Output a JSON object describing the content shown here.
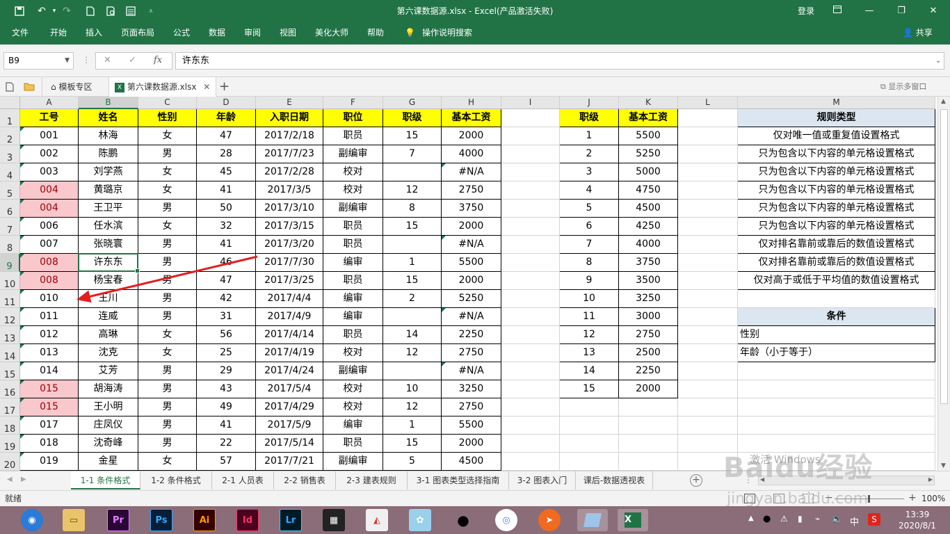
{
  "window": {
    "title": "第六课数据源.xlsx  -  Excel(产品激活失败)",
    "login": "登录"
  },
  "ribbon": {
    "tabs": [
      "文件",
      "开始",
      "插入",
      "页面布局",
      "公式",
      "数据",
      "审阅",
      "视图",
      "美化大师",
      "帮助",
      "操作说明搜索"
    ],
    "share": "共享"
  },
  "formula_bar": {
    "name_box": "B9",
    "content": "许东东",
    "fx": "fx"
  },
  "doc_tabs": {
    "template": "模板专区",
    "file": "第六课数据源.xlsx",
    "multi_window": "显示多窗口"
  },
  "columns": [
    "A",
    "B",
    "C",
    "D",
    "E",
    "F",
    "G",
    "H",
    "I",
    "J",
    "K",
    "L",
    "M"
  ],
  "rows": [
    "1",
    "2",
    "3",
    "4",
    "5",
    "6",
    "7",
    "8",
    "9",
    "10",
    "11",
    "12",
    "13",
    "14",
    "15",
    "16",
    "17",
    "18",
    "19",
    "20"
  ],
  "table1": {
    "headers": [
      "工号",
      "姓名",
      "性别",
      "年龄",
      "入职日期",
      "职位",
      "职级",
      "基本工资"
    ],
    "rows": [
      [
        "001",
        "林海",
        "女",
        "47",
        "2017/2/18",
        "职员",
        "15",
        "2000"
      ],
      [
        "002",
        "陈鹏",
        "男",
        "28",
        "2017/7/23",
        "副编审",
        "7",
        "4000"
      ],
      [
        "003",
        "刘学燕",
        "女",
        "45",
        "2017/2/28",
        "校对",
        "",
        "#N/A"
      ],
      [
        "004",
        "黄璐京",
        "女",
        "41",
        "2017/3/5",
        "校对",
        "12",
        "2750"
      ],
      [
        "004",
        "王卫平",
        "男",
        "50",
        "2017/3/10",
        "副编审",
        "8",
        "3750"
      ],
      [
        "006",
        "任水滨",
        "女",
        "32",
        "2017/3/15",
        "职员",
        "15",
        "2000"
      ],
      [
        "007",
        "张晓寰",
        "男",
        "41",
        "2017/3/20",
        "职员",
        "",
        "#N/A"
      ],
      [
        "008",
        "许东东",
        "男",
        "46",
        "2017/7/30",
        "编审",
        "1",
        "5500"
      ],
      [
        "008",
        "杨宝春",
        "男",
        "47",
        "2017/3/25",
        "职员",
        "15",
        "2000"
      ],
      [
        "010",
        "王川",
        "男",
        "42",
        "2017/4/4",
        "编审",
        "2",
        "5250"
      ],
      [
        "011",
        "连威",
        "男",
        "31",
        "2017/4/9",
        "编审",
        "",
        "#N/A"
      ],
      [
        "012",
        "高琳",
        "女",
        "56",
        "2017/4/14",
        "职员",
        "14",
        "2250"
      ],
      [
        "013",
        "沈克",
        "女",
        "25",
        "2017/4/19",
        "校对",
        "12",
        "2750"
      ],
      [
        "014",
        "艾芳",
        "男",
        "29",
        "2017/4/24",
        "副编审",
        "",
        "#N/A"
      ],
      [
        "015",
        "胡海涛",
        "男",
        "43",
        "2017/5/4",
        "校对",
        "10",
        "3250"
      ],
      [
        "015",
        "王小明",
        "男",
        "49",
        "2017/4/29",
        "校对",
        "12",
        "2750"
      ],
      [
        "017",
        "庄凤仪",
        "男",
        "41",
        "2017/5/9",
        "编审",
        "1",
        "5500"
      ],
      [
        "018",
        "沈奇峰",
        "男",
        "22",
        "2017/5/14",
        "职员",
        "15",
        "2000"
      ],
      [
        "019",
        "金星",
        "女",
        "57",
        "2017/7/21",
        "副编审",
        "5",
        "4500"
      ]
    ],
    "duplicate_rows": [
      3,
      4,
      7,
      8,
      14,
      15
    ]
  },
  "table2": {
    "headers": [
      "职级",
      "基本工资"
    ],
    "rows": [
      [
        "1",
        "5500"
      ],
      [
        "2",
        "5250"
      ],
      [
        "3",
        "5000"
      ],
      [
        "4",
        "4750"
      ],
      [
        "5",
        "4500"
      ],
      [
        "6",
        "4250"
      ],
      [
        "7",
        "4000"
      ],
      [
        "8",
        "3750"
      ],
      [
        "9",
        "3500"
      ],
      [
        "10",
        "3250"
      ],
      [
        "11",
        "3000"
      ],
      [
        "12",
        "2750"
      ],
      [
        "13",
        "2500"
      ],
      [
        "14",
        "2250"
      ],
      [
        "15",
        "2000"
      ]
    ]
  },
  "table3": {
    "header": "规则类型",
    "rows": [
      "仅对唯一值或重复值设置格式",
      "只为包含以下内容的单元格设置格式",
      "只为包含以下内容的单元格设置格式",
      "只为包含以下内容的单元格设置格式",
      "只为包含以下内容的单元格设置格式",
      "只为包含以下内容的单元格设置格式",
      "仅对排名靠前或靠后的数值设置格式",
      "仅对排名靠前或靠后的数值设置格式",
      "仅对高于或低于平均值的数值设置格式"
    ],
    "cond_header": "条件",
    "cond_rows": [
      "性别",
      "年龄（小于等于）"
    ]
  },
  "sheet_tabs": [
    "1-1 条件格式",
    "1-2 条件格式",
    "2-1 人员表",
    "2-2 销售表",
    "2-3 建表规则",
    "3-1 图表类型选择指南",
    "3-2 图表入门",
    "课后-数据透视表"
  ],
  "status": {
    "ready": "就绪",
    "zoom": "100%"
  },
  "taskbar": {
    "apps": [
      "Pr",
      "Ps",
      "Ai",
      "Id",
      "Lr"
    ],
    "time": "13:39",
    "date": "2020/8/1",
    "ime": "中"
  },
  "watermark": {
    "logo": "Baidu经验",
    "url": "jingyan.baidu.com",
    "activate": "激活 Windows"
  },
  "colors": {
    "excel_green": "#217346",
    "header_yellow": "#ffff00",
    "duplicate_fill": "#f8c8cc",
    "rule_header": "#dce6f1",
    "annotation_arrow": "#e41e1e"
  }
}
